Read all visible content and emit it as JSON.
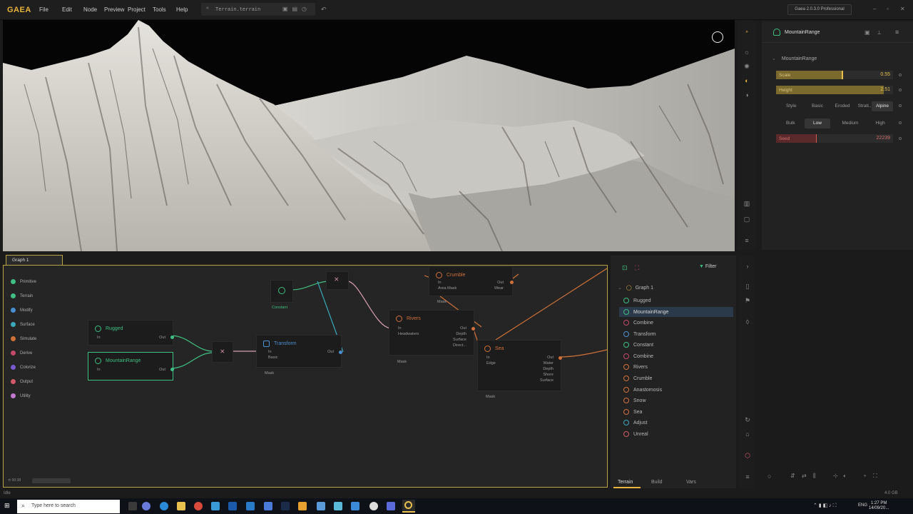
{
  "app": {
    "logo": "GAEA",
    "edition": "Gaea 2.0.3.0 Professional",
    "file_name": "Terrain.terrain",
    "status": "Idle",
    "disk": "4.0 GB"
  },
  "menu": [
    "File",
    "Edit",
    "Node",
    "Preview",
    "Project",
    "Tools",
    "Help"
  ],
  "properties": {
    "node_title": "MountainRange",
    "section": "MountainRange",
    "scale": {
      "label": "Scale",
      "value": "0.55",
      "fraction": 0.55
    },
    "height": {
      "label": "Height",
      "value": "2.51",
      "fraction": 0.92
    },
    "style": {
      "label": "Style",
      "options": [
        "Basic",
        "Eroded",
        "Strati...",
        "Alpine"
      ],
      "selected": "Alpine"
    },
    "bulk": {
      "label": "Bulk",
      "options": [
        "Low",
        "Medium",
        "High"
      ],
      "selected": "Low"
    },
    "seed": {
      "label": "Seed",
      "value": "22239",
      "fraction": 0.34
    }
  },
  "graph": {
    "tab": "Graph 1",
    "timer": "00:38",
    "categories": [
      {
        "label": "Primitive",
        "color": "#3fbf84"
      },
      {
        "label": "Terrain",
        "color": "#3fbf84"
      },
      {
        "label": "Modify",
        "color": "#4a8fd0"
      },
      {
        "label": "Surface",
        "color": "#3aa8b8"
      },
      {
        "label": "Simulate",
        "color": "#d0713a"
      },
      {
        "label": "Derive",
        "color": "#c24a6a"
      },
      {
        "label": "Colorize",
        "color": "#7a5ad0"
      },
      {
        "label": "Output",
        "color": "#d05a6a"
      },
      {
        "label": "Utility",
        "color": "#c27ad0"
      }
    ],
    "nodes": {
      "rugged": {
        "title": "Rugged",
        "in": "In",
        "out": "Out"
      },
      "mountain": {
        "title": "MountainRange",
        "in": "In",
        "out": "Out"
      },
      "transform": {
        "title": "Transform",
        "in": "In",
        "basic": "Basic",
        "out": "Out",
        "mask": "Mask"
      },
      "constant": {
        "title": "Constant"
      },
      "rivers": {
        "title": "Rivers",
        "in": "In",
        "headwaters": "Headwaters",
        "outs": [
          "Out",
          "Depth",
          "Surface",
          "Direct..."
        ],
        "mask": "Mask"
      },
      "crumble": {
        "title": "Crumble",
        "in": "In",
        "area_mask": "Area Mask",
        "outs": [
          "Out",
          "Wear"
        ],
        "mask": "Mask"
      },
      "sea": {
        "title": "Sea",
        "in": "In",
        "edge": "Edge",
        "outs": [
          "Out",
          "Water",
          "Depth",
          "Shore",
          "Surface"
        ],
        "mask": "Mask"
      }
    }
  },
  "layers": {
    "filter_label": "Filter",
    "root": "Graph 1",
    "items": [
      {
        "label": "Rugged",
        "color": "#3fbf84"
      },
      {
        "label": "MountainRange",
        "color": "#3fbf84"
      },
      {
        "label": "Combine",
        "color": "#c24a6a"
      },
      {
        "label": "Transform",
        "color": "#4a8fd0"
      },
      {
        "label": "Constant",
        "color": "#3fbf84"
      },
      {
        "label": "Combine",
        "color": "#c24a6a"
      },
      {
        "label": "Rivers",
        "color": "#d0713a"
      },
      {
        "label": "Crumble",
        "color": "#d0713a"
      },
      {
        "label": "Anastomosis",
        "color": "#d0713a"
      },
      {
        "label": "Snow",
        "color": "#d0713a"
      },
      {
        "label": "Sea",
        "color": "#d0713a"
      },
      {
        "label": "Adjust",
        "color": "#3aa8b8"
      },
      {
        "label": "Unreal",
        "color": "#d05a6a"
      }
    ],
    "selected": "MountainRange",
    "tabs": [
      "Terrain",
      "Build",
      "Vars"
    ]
  },
  "taskbar": {
    "search_placeholder": "Type here to search",
    "time": "1:27 PM",
    "date": "14/09/20...",
    "lang": "ENG"
  }
}
